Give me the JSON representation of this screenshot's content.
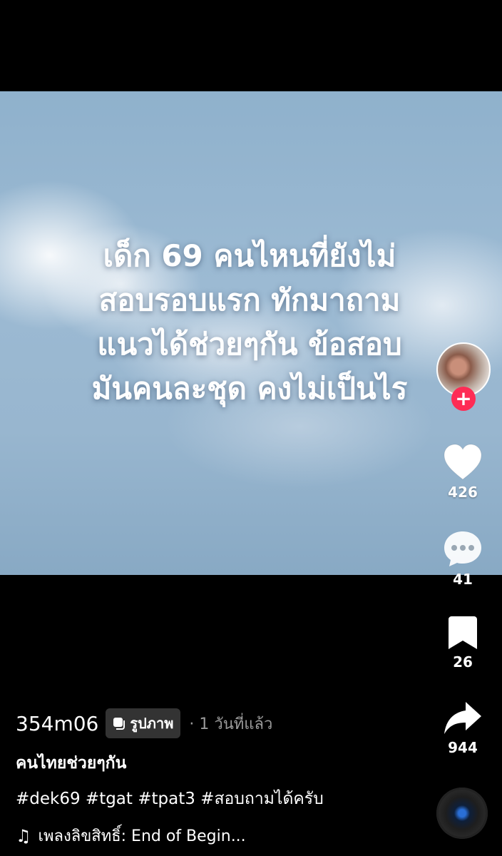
{
  "post": {
    "overlay_lines": [
      "เด็ก 69 คนไหนที่ยังไม่",
      "สอบรอบแรก ทักมาถาม",
      "แนวได้ช่วยๆกัน ข้อสอบ",
      "มันคนละชุด คงไม่เป็นไร"
    ]
  },
  "actions": {
    "like_count": "426",
    "comment_count": "41",
    "bookmark_count": "26",
    "share_count": "944"
  },
  "caption": {
    "username": "354m06",
    "type_badge": "รูปภาพ",
    "time_ago": "· 1 วันที่แล้ว",
    "description": "คนไทยช่วยๆกัน",
    "hashtags": "#dek69 #tgat #tpat3 #สอบถามได้ครับ",
    "music_note": "♫",
    "music": "เพลงลิขสิทธิ์: End of Begin..."
  },
  "colors": {
    "follow_accent": "#fe2c55",
    "background": "#000000"
  },
  "icons": [
    "heart-icon",
    "comment-icon",
    "bookmark-icon",
    "share-icon",
    "plus-icon",
    "music-note-icon",
    "photo-icon"
  ]
}
